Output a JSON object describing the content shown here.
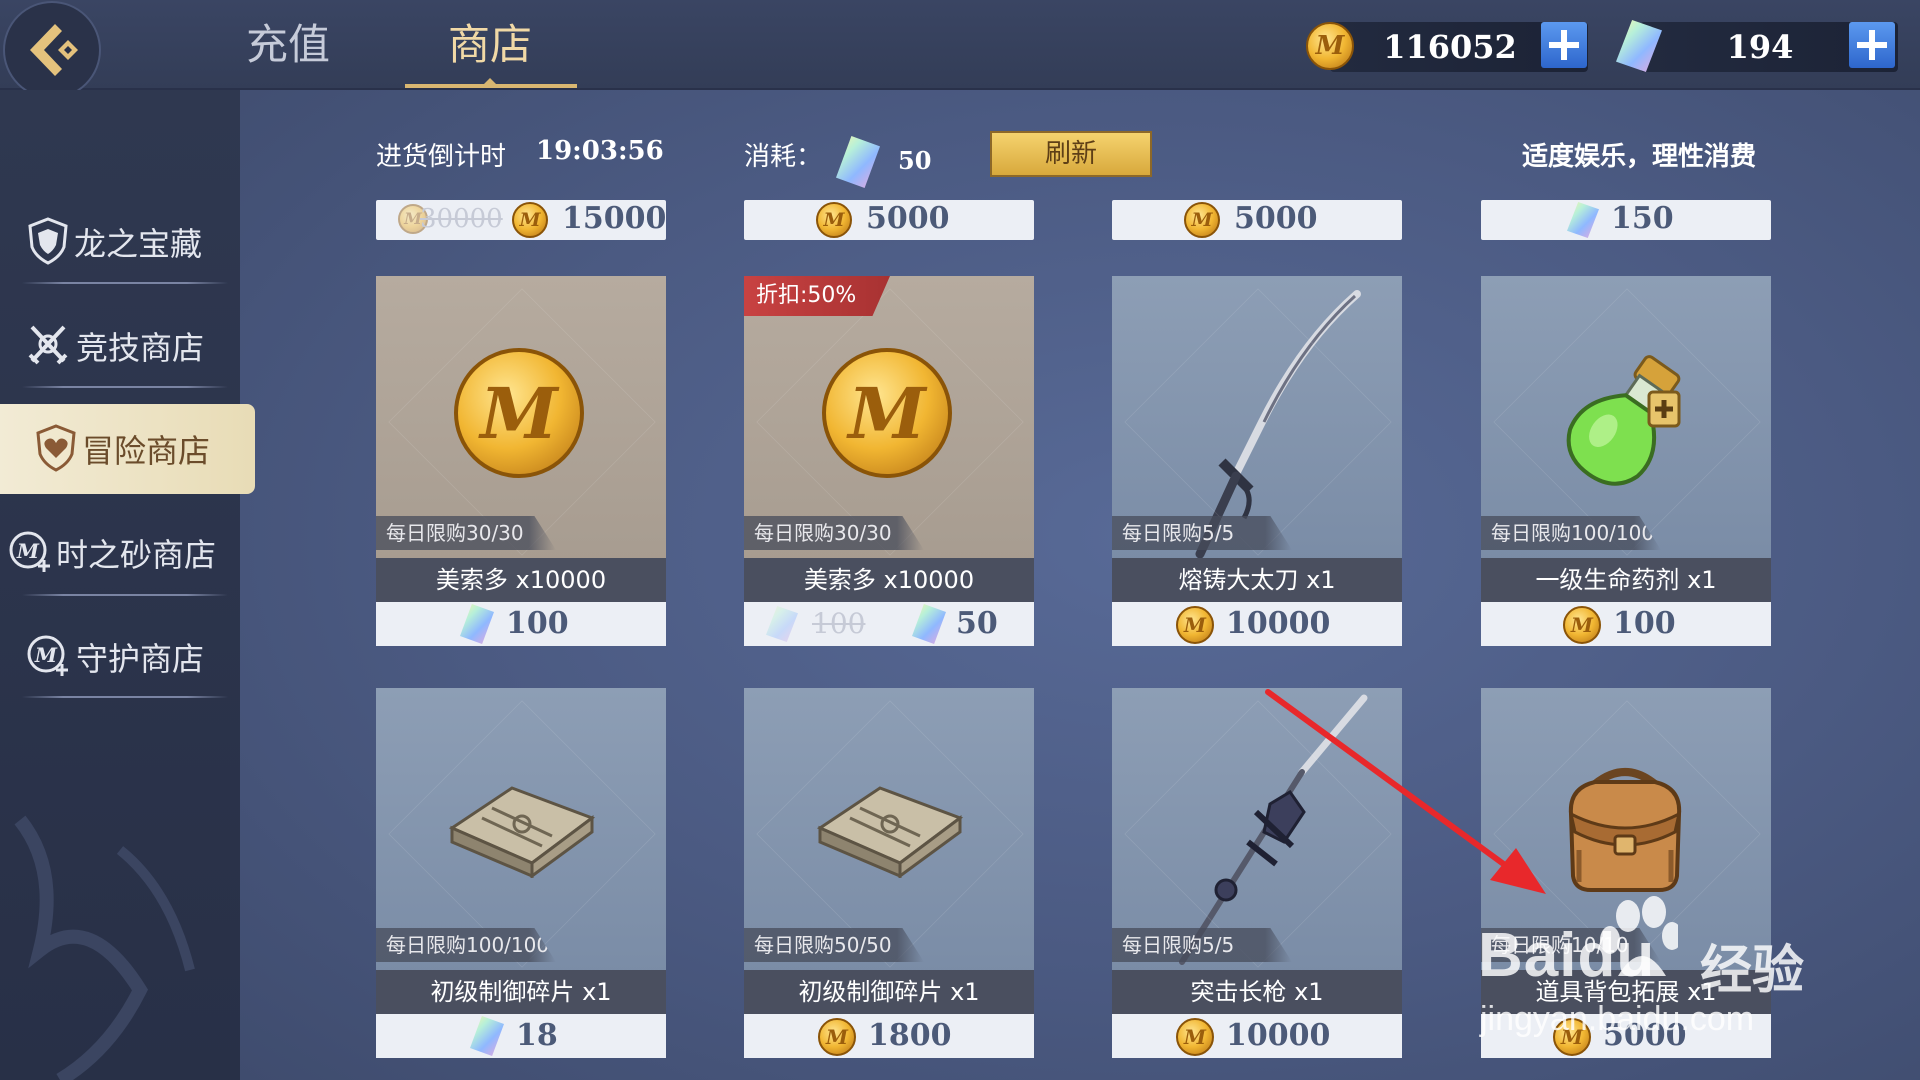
{
  "tabs": [
    {
      "label": "充值",
      "active": false
    },
    {
      "label": "商店",
      "active": true
    }
  ],
  "resources": {
    "coins": "116052",
    "gems": "194"
  },
  "sidebar": {
    "items": [
      {
        "label": "龙之宝藏",
        "icon": "dragon-shield-icon"
      },
      {
        "label": "竞技商店",
        "icon": "crossed-swords-icon"
      },
      {
        "label": "冒险商店",
        "icon": "heart-shield-icon",
        "active": true
      },
      {
        "label": "时之砂商店",
        "icon": "coin-plus-icon"
      },
      {
        "label": "守护商店",
        "icon": "coin-plus-icon"
      }
    ]
  },
  "info": {
    "restock_label": "进货倒计时",
    "restock_time": "19:03:56",
    "cost_label": "消耗：",
    "cost_value": "50",
    "refresh": "刷新",
    "notice": "适度娱乐，理性消费"
  },
  "top_prices": [
    {
      "original": "30000",
      "price": "15000",
      "currency": "coin"
    },
    {
      "price": "5000",
      "currency": "coin"
    },
    {
      "price": "5000",
      "currency": "coin"
    },
    {
      "price": "150",
      "currency": "gem"
    }
  ],
  "items": [
    {
      "name": "美索多 x10000",
      "limit": "每日限购30/30",
      "price": "100",
      "currency": "gem",
      "art": "coin"
    },
    {
      "name": "美索多 x10000",
      "limit": "每日限购30/30",
      "price": "50",
      "original": "100",
      "currency": "gem",
      "discount": "折扣:50%",
      "art": "coin"
    },
    {
      "name": "熔铸大太刀 x1",
      "limit": "每日限购5/5",
      "price": "10000",
      "currency": "coin",
      "art": "katana"
    },
    {
      "name": "一级生命药剂 x1",
      "limit": "每日限购100/100",
      "price": "100",
      "currency": "coin",
      "art": "potion"
    },
    {
      "name": "初级制御碎片 x1",
      "limit": "每日限购100/100",
      "price": "18",
      "currency": "gem",
      "art": "fragment"
    },
    {
      "name": "初级制御碎片 x1",
      "limit": "每日限购50/50",
      "price": "1800",
      "currency": "coin",
      "art": "fragment"
    },
    {
      "name": "突击长枪 x1",
      "limit": "每日限购5/5",
      "price": "10000",
      "currency": "coin",
      "art": "spear"
    },
    {
      "name": "道具背包拓展 x1",
      "limit": "每日限购10/10",
      "price": "5000",
      "currency": "coin",
      "art": "backpack"
    }
  ],
  "watermark": {
    "brand": "Baidu",
    "suffix": "经验",
    "url": "jingyan.baidu.com"
  },
  "colors": {
    "accent_gold": "#d9b771",
    "plus_blue": "#3d7ddd",
    "discount_red": "#c84242",
    "annotation_arrow": "#e8282b"
  }
}
